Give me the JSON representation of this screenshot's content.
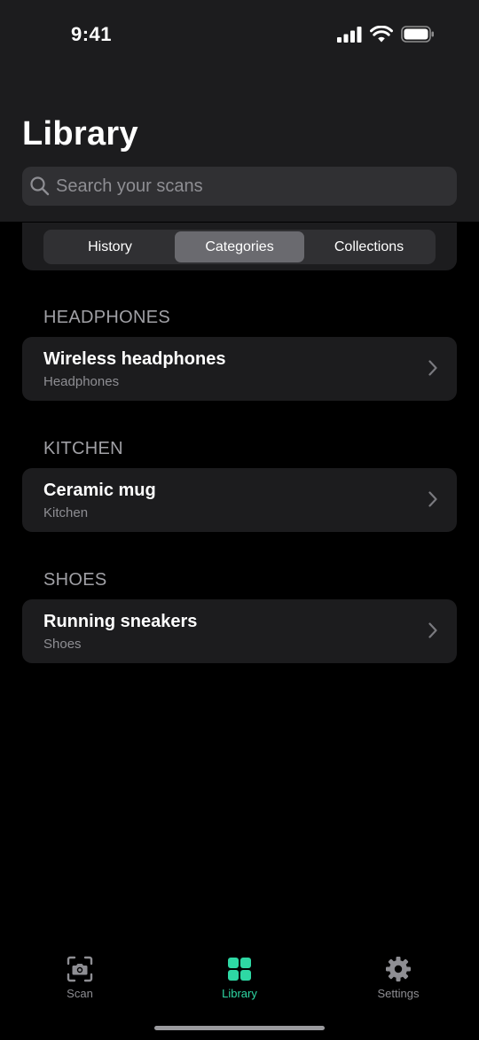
{
  "status_bar": {
    "time": "9:41"
  },
  "header": {
    "title": "Library"
  },
  "search": {
    "placeholder": "Search your scans",
    "value": ""
  },
  "segments": {
    "items": [
      "History",
      "Categories",
      "Collections"
    ],
    "selected": "Categories"
  },
  "sections": [
    {
      "header": "HEADPHONES",
      "items": [
        {
          "title": "Wireless headphones",
          "subtitle": "Headphones"
        }
      ]
    },
    {
      "header": "KITCHEN",
      "items": [
        {
          "title": "Ceramic mug",
          "subtitle": "Kitchen"
        }
      ]
    },
    {
      "header": "SHOES",
      "items": [
        {
          "title": "Running sneakers",
          "subtitle": "Shoes"
        }
      ]
    }
  ],
  "tabbar": {
    "tabs": [
      {
        "label": "Scan",
        "icon": "camera-icon"
      },
      {
        "label": "Library",
        "icon": "grid-icon"
      },
      {
        "label": "Settings",
        "icon": "gear-icon"
      }
    ],
    "active": "Library"
  },
  "colors": {
    "accent": "#2ed8a4",
    "background": "#000000",
    "surface": "#1c1c1e"
  }
}
